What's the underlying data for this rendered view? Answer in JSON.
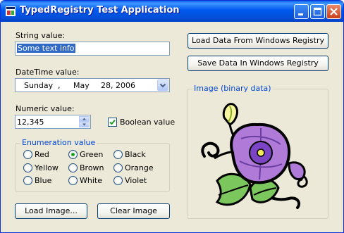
{
  "window": {
    "title": "TypedRegistry Test Application"
  },
  "string_field": {
    "label": "String value:",
    "value": "Some text info"
  },
  "datetime_field": {
    "label": "DateTime value:",
    "day": "Sunday",
    "sep": ",",
    "month": "May",
    "date": "28, 2006"
  },
  "numeric_field": {
    "label": "Numeric value:",
    "value": "12,345"
  },
  "boolean_checkbox": {
    "label": "Boolean value",
    "checked": true
  },
  "enumeration": {
    "title": "Enumeration value",
    "options": [
      "Red",
      "Green",
      "Black",
      "Yellow",
      "Brown",
      "Orange",
      "Blue",
      "White",
      "Violet"
    ],
    "selected": "Green"
  },
  "buttons": {
    "load_registry": "Load Data From Windows Registry",
    "save_registry": "Save Data In Windows Registry",
    "load_image": "Load Image...",
    "clear_image": "Clear Image"
  },
  "image_group": {
    "title": "Image (binary data)"
  },
  "icons": [
    "app-icon",
    "minimize-icon",
    "maximize-icon",
    "close-icon",
    "spin-up-icon",
    "spin-down-icon",
    "dropdown-arrow-icon",
    "checkmark-icon",
    "morning-glory-image"
  ],
  "colors": {
    "titlebar": "#0058ee",
    "selection": "#316ac5",
    "group_title": "#0046d5",
    "face": "#ece9d8"
  }
}
